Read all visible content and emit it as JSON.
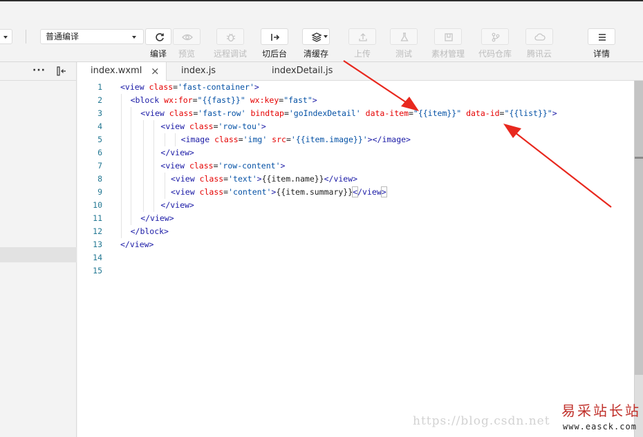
{
  "toolbar": {
    "compile_mode": "普通编译",
    "buttons": [
      {
        "label": "编译",
        "icon": "refresh-icon",
        "enabled": true
      },
      {
        "label": "预览",
        "icon": "eye-icon",
        "enabled": false
      },
      {
        "label": "远程调试",
        "icon": "bug-icon",
        "enabled": false
      },
      {
        "label": "切后台",
        "icon": "switch-background-icon",
        "enabled": true
      },
      {
        "label": "清缓存",
        "icon": "layers-icon",
        "enabled": true
      },
      {
        "label": "上传",
        "icon": "upload-icon",
        "enabled": false
      },
      {
        "label": "测试",
        "icon": "flask-icon",
        "enabled": false
      },
      {
        "label": "素材管理",
        "icon": "box-icon",
        "enabled": false
      },
      {
        "label": "代码仓库",
        "icon": "branch-icon",
        "enabled": false
      },
      {
        "label": "腾讯云",
        "icon": "cloud-icon",
        "enabled": false
      },
      {
        "label": "详情",
        "icon": "menu-icon",
        "enabled": true
      }
    ]
  },
  "left_panel": {
    "more_icon": "ellipsis-icon",
    "collapse_icon": "collapse-panel-icon"
  },
  "tabs": [
    {
      "label": "index.wxml",
      "active": true
    },
    {
      "label": "index.js",
      "active": false
    },
    {
      "label": "indexDetail.js",
      "active": false
    }
  ],
  "editor": {
    "line_numbers": [
      "1",
      "2",
      "3",
      "4",
      "5",
      "6",
      "7",
      "8",
      "9",
      "10",
      "11",
      "12",
      "13",
      "14",
      "15"
    ],
    "lines": [
      {
        "indent": 0,
        "tokens": [
          [
            "tag",
            "<view "
          ],
          [
            "attr",
            "class"
          ],
          [
            "txt",
            "="
          ],
          [
            "str",
            "'fast-container'"
          ],
          [
            "tag",
            ">"
          ]
        ]
      },
      {
        "indent": 1,
        "tokens": [
          [
            "tag",
            "<block "
          ],
          [
            "attr",
            "wx:for"
          ],
          [
            "txt",
            "="
          ],
          [
            "str",
            "\"{{fast}}\" "
          ],
          [
            "attr",
            "wx:key"
          ],
          [
            "txt",
            "="
          ],
          [
            "str",
            "\"fast\""
          ],
          [
            "tag",
            ">"
          ]
        ]
      },
      {
        "indent": 2,
        "tokens": [
          [
            "tag",
            "<view "
          ],
          [
            "attr",
            "class"
          ],
          [
            "txt",
            "="
          ],
          [
            "str",
            "'fast-row' "
          ],
          [
            "attr",
            "bindtap"
          ],
          [
            "txt",
            "="
          ],
          [
            "str",
            "'goIndexDetail' "
          ],
          [
            "attr",
            "data-item"
          ],
          [
            "txt",
            "="
          ],
          [
            "str",
            "\"{{item}}\" "
          ],
          [
            "attr",
            "data-id"
          ],
          [
            "txt",
            "="
          ],
          [
            "str",
            "\"{{list}}\""
          ],
          [
            "tag",
            ">"
          ]
        ]
      },
      {
        "indent": 4,
        "tokens": [
          [
            "tag",
            "<view "
          ],
          [
            "attr",
            "class"
          ],
          [
            "txt",
            "="
          ],
          [
            "str",
            "'row-tou'"
          ],
          [
            "tag",
            ">"
          ]
        ]
      },
      {
        "indent": 6,
        "tokens": [
          [
            "tag",
            "<image "
          ],
          [
            "attr",
            "class"
          ],
          [
            "txt",
            "="
          ],
          [
            "str",
            "'img' "
          ],
          [
            "attr",
            "src"
          ],
          [
            "txt",
            "="
          ],
          [
            "str",
            "'{{item.image}}'"
          ],
          [
            "tag",
            "></image>"
          ]
        ]
      },
      {
        "indent": 4,
        "tokens": [
          [
            "tag",
            "</view>"
          ]
        ]
      },
      {
        "indent": 4,
        "tokens": [
          [
            "tag",
            "<view "
          ],
          [
            "attr",
            "class"
          ],
          [
            "txt",
            "="
          ],
          [
            "str",
            "'row-content'"
          ],
          [
            "tag",
            ">"
          ]
        ]
      },
      {
        "indent": 5,
        "tokens": [
          [
            "tag",
            "<view "
          ],
          [
            "attr",
            "class"
          ],
          [
            "txt",
            "="
          ],
          [
            "str",
            "'text'"
          ],
          [
            "tag",
            ">"
          ],
          [
            "txt",
            "{{item.name}}"
          ],
          [
            "tag",
            "</view>"
          ]
        ]
      },
      {
        "indent": 5,
        "tokens": [
          [
            "tag",
            "<view "
          ],
          [
            "attr",
            "class"
          ],
          [
            "txt",
            "="
          ],
          [
            "str",
            "'content'"
          ],
          [
            "tag",
            ">"
          ],
          [
            "txt",
            "{{item.summary}}"
          ],
          [
            "hl",
            "<"
          ],
          [
            "tag",
            "/view"
          ],
          [
            "hl",
            ">"
          ]
        ]
      },
      {
        "indent": 4,
        "tokens": [
          [
            "tag",
            "</view>"
          ]
        ]
      },
      {
        "indent": 2,
        "tokens": [
          [
            "tag",
            "</view>"
          ]
        ]
      },
      {
        "indent": 1,
        "tokens": [
          [
            "tag",
            "</block>"
          ]
        ]
      },
      {
        "indent": 0,
        "tokens": [
          [
            "tag",
            "</view>"
          ]
        ]
      },
      {
        "indent": 0,
        "tokens": []
      },
      {
        "indent": 0,
        "tokens": []
      }
    ]
  },
  "annotation": {
    "arrow_color": "#e8281e"
  },
  "watermark": {
    "url": "https://blog.csdn.net",
    "logo": "易采站长站",
    "site": "www.easck.com"
  },
  "colors": {
    "tag": "#1a1aa6",
    "attr": "#e50000",
    "string": "#0451a5",
    "line_number": "#237893"
  }
}
